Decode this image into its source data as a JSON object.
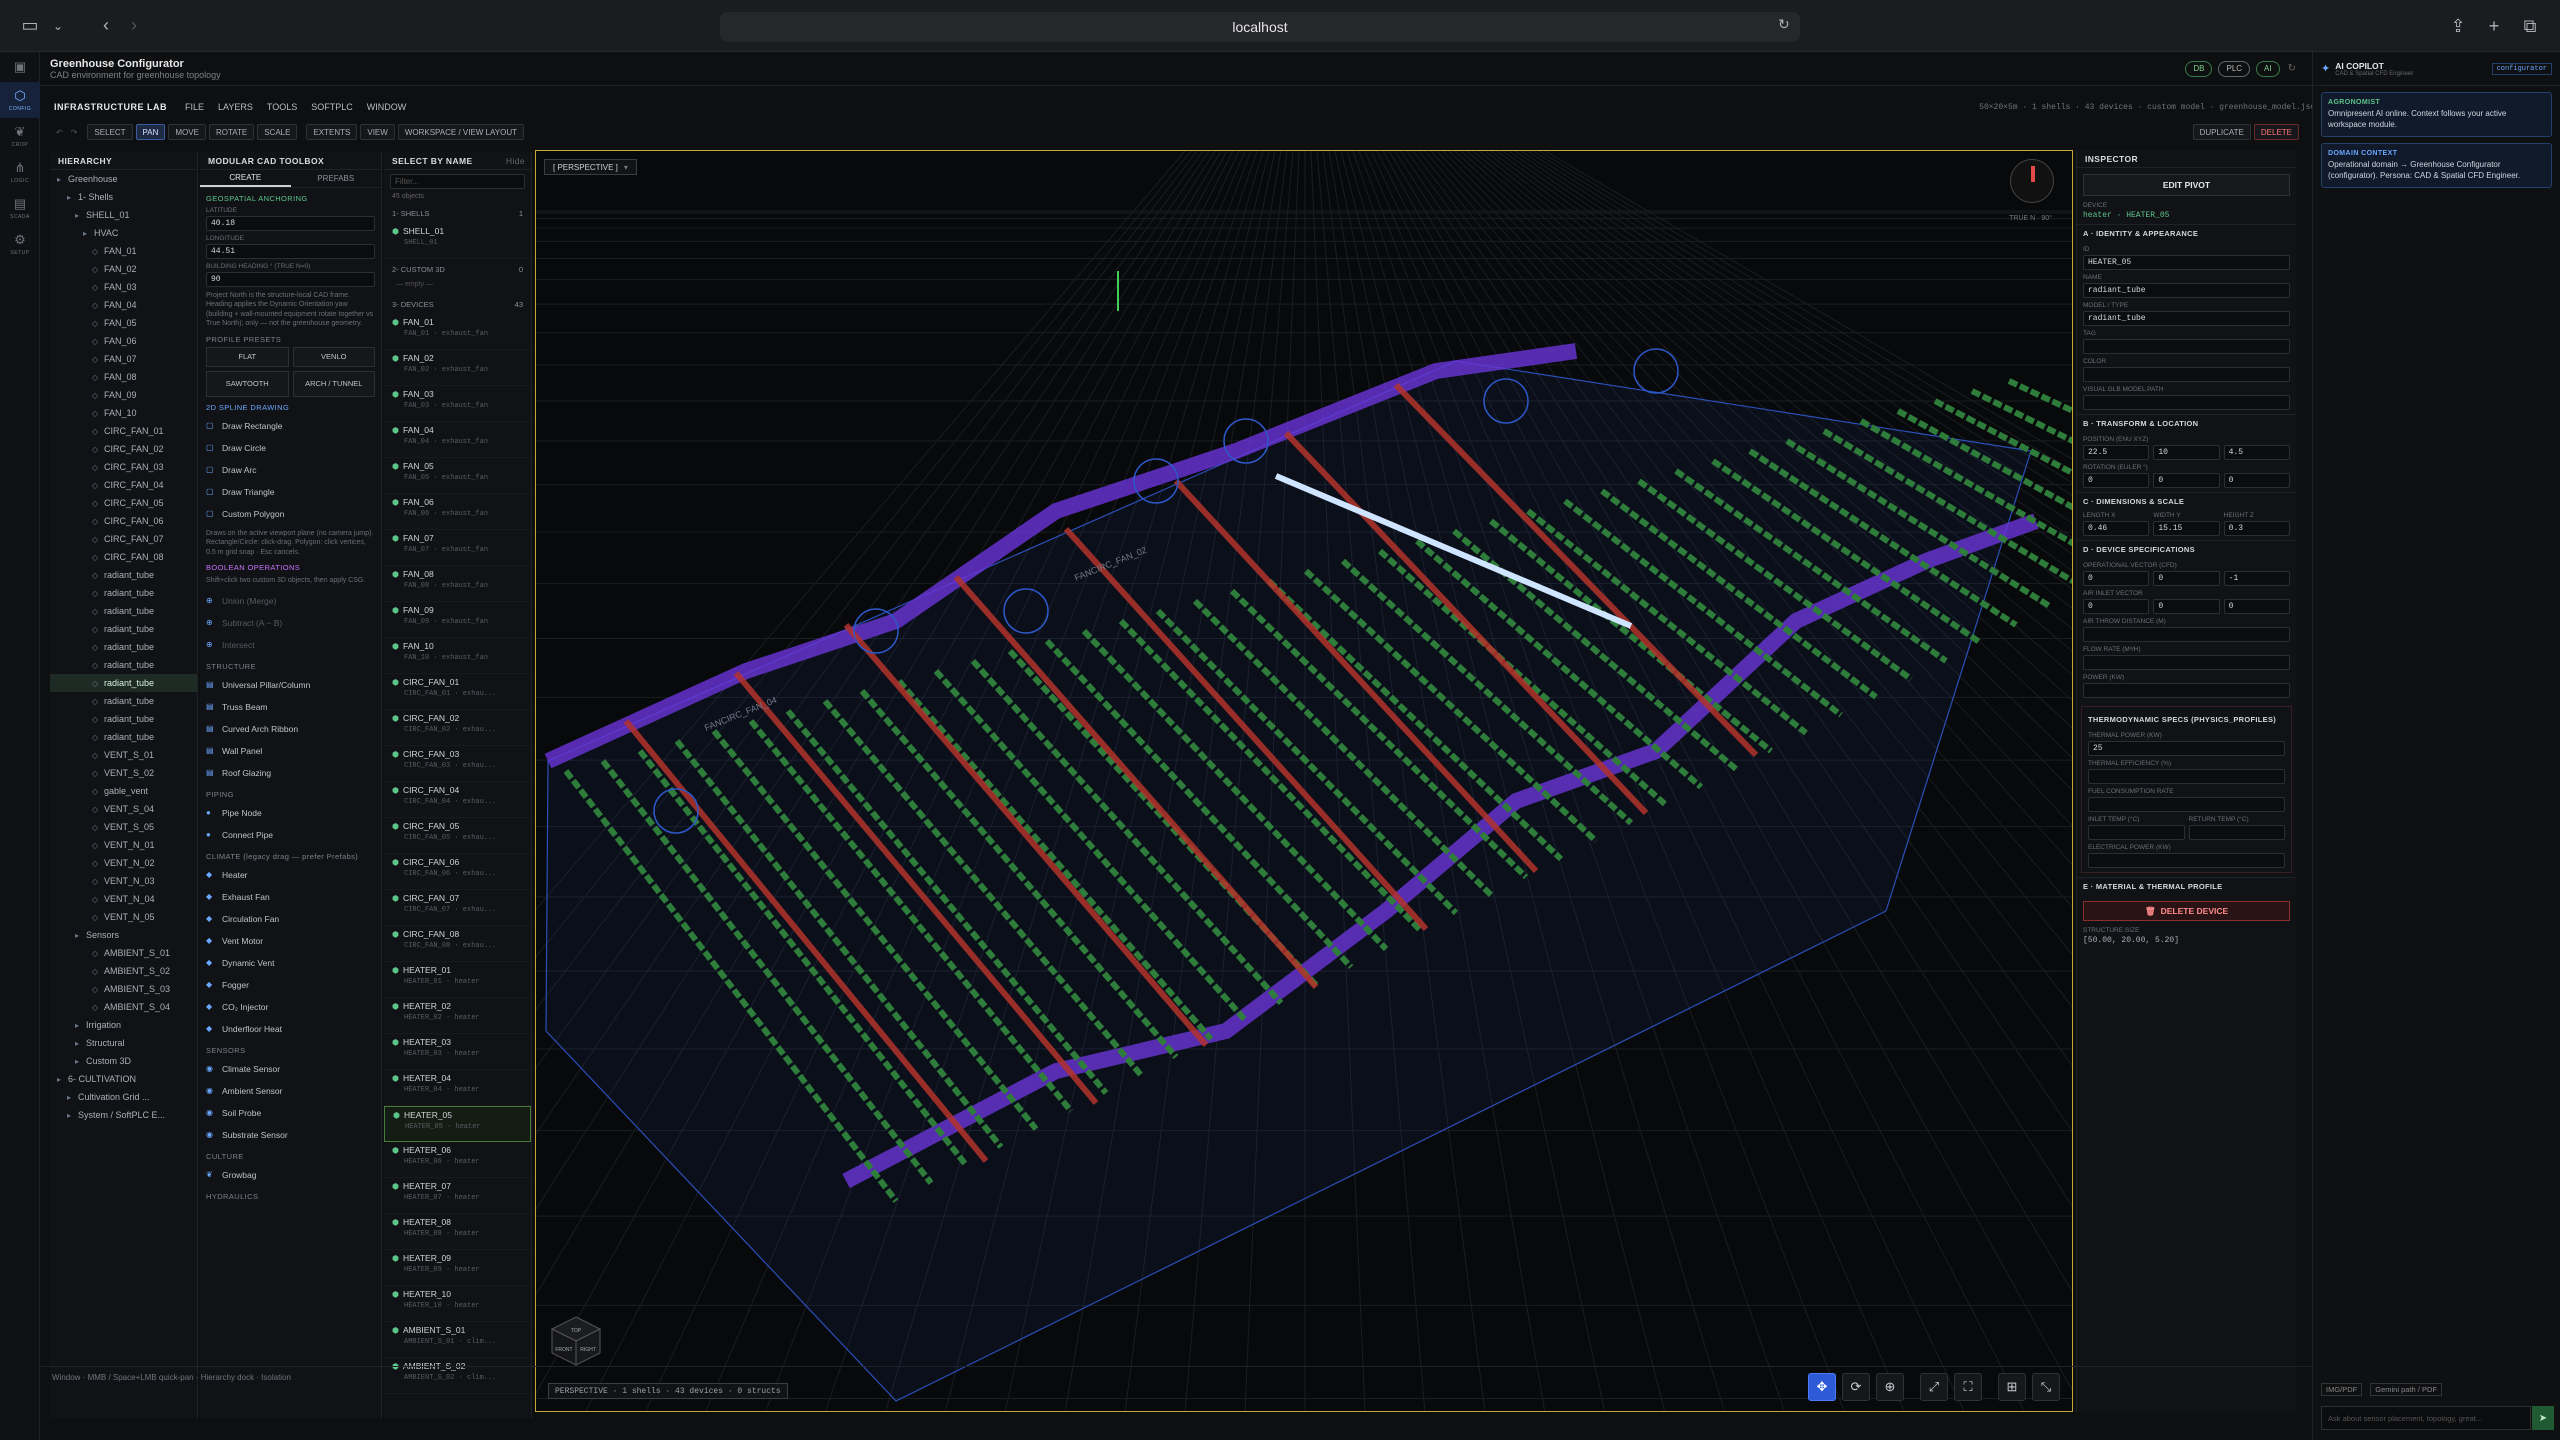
{
  "browser": {
    "url": "localhost"
  },
  "app": {
    "title": "Greenhouse Configurator",
    "subtitle": "CAD environment for greenhouse topology",
    "pills": [
      "DB",
      "PLC",
      "AI"
    ]
  },
  "rail": [
    {
      "label": "CONFIG"
    },
    {
      "label": "CROP"
    },
    {
      "label": "LOGIC"
    },
    {
      "label": "SCADA"
    },
    {
      "label": "SETUP"
    }
  ],
  "menu": {
    "brand": "INFRASTRUCTURE LAB",
    "items": [
      "FILE",
      "LAYERS",
      "TOOLS",
      "SOFTPLC",
      "WINDOW"
    ],
    "right": "50×20×5m · 1 shells · 43 devices · custom model · greenhouse_model.json"
  },
  "toolbar": {
    "tools": [
      "SELECT",
      "PAN",
      "MOVE",
      "ROTATE",
      "SCALE",
      "EXTENTS",
      "VIEW",
      "WORKSPACE / VIEW LAYOUT"
    ],
    "duplicate": "DUPLICATE",
    "delete": "DELETE"
  },
  "hierarchy": {
    "title": "HIERARCHY",
    "rows": [
      "Greenhouse",
      "1- Shells",
      "SHELL_01",
      "HVAC",
      "FAN_01",
      "FAN_02",
      "FAN_03",
      "FAN_04",
      "FAN_05",
      "FAN_06",
      "FAN_07",
      "FAN_08",
      "FAN_09",
      "FAN_10",
      "CIRC_FAN_01",
      "CIRC_FAN_02",
      "CIRC_FAN_03",
      "CIRC_FAN_04",
      "CIRC_FAN_05",
      "CIRC_FAN_06",
      "CIRC_FAN_07",
      "CIRC_FAN_08",
      "radiant_tube",
      "radiant_tube",
      "radiant_tube",
      "radiant_tube",
      "radiant_tube",
      "radiant_tube",
      "radiant_tube",
      "radiant_tube",
      "radiant_tube",
      "radiant_tube",
      "VENT_S_01",
      "VENT_S_02",
      "gable_vent",
      "VENT_S_04",
      "VENT_S_05",
      "VENT_N_01",
      "VENT_N_02",
      "VENT_N_03",
      "VENT_N_04",
      "VENT_N_05",
      "Sensors",
      "AMBIENT_S_01",
      "AMBIENT_S_02",
      "AMBIENT_S_03",
      "AMBIENT_S_04",
      "Irrigation",
      "Structural",
      "Custom 3D",
      "6- CULTIVATION",
      "Cultivation Grid ...",
      "System / SoftPLC E..."
    ]
  },
  "toolbox": {
    "title": "MODULAR CAD TOOLBOX",
    "tabs": [
      "CREATE",
      "PREFABS"
    ],
    "geo": {
      "title": "GEOSPATIAL ANCHORING",
      "lat_label": "LATITUDE",
      "lat": "40.18",
      "lon_label": "LONGITUDE",
      "lon": "44.51",
      "head_label": "BUILDING HEADING ° (TRUE N=0)",
      "head": "90",
      "note": "Project North is the structure-local CAD frame. Heading applies the Dynamic Orientation yaw (building + wall-mounted equipment rotate together vs True North); only — not the greenhouse geometry."
    },
    "presets": {
      "title": "PROFILE PRESETS",
      "items": [
        "FLAT",
        "VENLO",
        "SAWTOOTH",
        "ARCH / TUNNEL"
      ]
    },
    "spline": {
      "title": "2D SPLINE DRAWING",
      "items": [
        "Draw Rectangle",
        "Draw Circle",
        "Draw Arc",
        "Draw Triangle",
        "Custom Polygon"
      ],
      "note": "Draws on the active viewport plane (no camera jump). Rectangle/Circle: click-drag. Polygon: click vertices, 0.5 m grid snap · Esc cancels."
    },
    "bool": {
      "title": "BOOLEAN OPERATIONS",
      "note": "Shift+click two custom 3D objects, then apply CSG.",
      "items": [
        "Union (Merge)",
        "Subtract (A − B)",
        "Intersect"
      ]
    },
    "structure": {
      "title": "STRUCTURE",
      "items": [
        "Universal Pillar/Column",
        "Truss Beam",
        "Curved Arch Ribbon",
        "Wall Panel",
        "Roof Glazing"
      ]
    },
    "piping": {
      "title": "PIPING",
      "items": [
        "Pipe Node",
        "Connect Pipe"
      ]
    },
    "climate": {
      "title": "CLIMATE (legacy drag — prefer Prefabs)",
      "items": [
        "Heater",
        "Exhaust Fan",
        "Circulation Fan",
        "Vent Motor",
        "Dynamic Vent",
        "Fogger",
        "CO₂ Injector",
        "Underfloor Heat"
      ]
    },
    "sensors": {
      "title": "SENSORS",
      "items": [
        "Climate Sensor",
        "Ambient Sensor",
        "Soil Probe",
        "Substrate Sensor"
      ]
    },
    "culture": {
      "title": "CULTURE",
      "items": [
        "Growbag"
      ]
    },
    "hydraulics": {
      "title": "HYDRAULICS"
    }
  },
  "names": {
    "title": "SELECT BY NAME",
    "hide": "Hide",
    "filter_ph": "Filter...",
    "count": "45 objects",
    "groups": [
      {
        "label": "1- SHELLS",
        "count": "1",
        "items": [
          [
            "SHELL_01",
            "SHELL_01"
          ]
        ]
      },
      {
        "label": "2- CUSTOM 3D",
        "count": "0",
        "empty": "— empty —",
        "items": []
      },
      {
        "label": "3- DEVICES",
        "count": "43",
        "items": [
          [
            "FAN_01",
            "FAN_01 · exhaust_fan"
          ],
          [
            "FAN_02",
            "FAN_02 · exhaust_fan"
          ],
          [
            "FAN_03",
            "FAN_03 · exhaust_fan"
          ],
          [
            "FAN_04",
            "FAN_04 · exhaust_fan"
          ],
          [
            "FAN_05",
            "FAN_05 · exhaust_fan"
          ],
          [
            "FAN_06",
            "FAN_06 · exhaust_fan"
          ],
          [
            "FAN_07",
            "FAN_07 · exhaust_fan"
          ],
          [
            "FAN_08",
            "FAN_08 · exhaust_fan"
          ],
          [
            "FAN_09",
            "FAN_09 · exhaust_fan"
          ],
          [
            "FAN_10",
            "FAN_10 · exhaust_fan"
          ],
          [
            "CIRC_FAN_01",
            "CIRC_FAN_01 · exhau..."
          ],
          [
            "CIRC_FAN_02",
            "CIRC_FAN_02 · exhau..."
          ],
          [
            "CIRC_FAN_03",
            "CIRC_FAN_03 · exhau..."
          ],
          [
            "CIRC_FAN_04",
            "CIRC_FAN_04 · exhau..."
          ],
          [
            "CIRC_FAN_05",
            "CIRC_FAN_05 · exhau..."
          ],
          [
            "CIRC_FAN_06",
            "CIRC_FAN_06 · exhau..."
          ],
          [
            "CIRC_FAN_07",
            "CIRC_FAN_07 · exhau..."
          ],
          [
            "CIRC_FAN_08",
            "CIRC_FAN_08 · exhau..."
          ],
          [
            "HEATER_01",
            "HEATER_01 · heater"
          ],
          [
            "HEATER_02",
            "HEATER_02 · heater"
          ],
          [
            "HEATER_03",
            "HEATER_03 · heater"
          ],
          [
            "HEATER_04",
            "HEATER_04 · heater"
          ],
          [
            "HEATER_05",
            "HEATER_05 · heater"
          ],
          [
            "HEATER_06",
            "HEATER_06 · heater"
          ],
          [
            "HEATER_07",
            "HEATER_07 · heater"
          ],
          [
            "HEATER_08",
            "HEATER_08 · heater"
          ],
          [
            "HEATER_09",
            "HEATER_09 · heater"
          ],
          [
            "HEATER_10",
            "HEATER_10 · heater"
          ],
          [
            "AMBIENT_S_01",
            "AMBIENT_S_01 · clim..."
          ],
          [
            "AMBIENT_S_02",
            "AMBIENT_S_02 · clim..."
          ]
        ]
      }
    ],
    "selected": "HEATER_05"
  },
  "viewport": {
    "badge": "[ PERSPECTIVE ]",
    "status": "PERSPECTIVE · 1 shells · 43 devices · 0 structs",
    "compass": "TRUE N · 90°",
    "labels": [
      "FANCIRC_FAN_04",
      "FANCIRC_FAN_02"
    ],
    "cube": [
      "TOP",
      "FRONT",
      "RIGHT"
    ]
  },
  "inspector": {
    "title": "INSPECTOR",
    "edit_pivot": "EDIT PIVOT",
    "device_label": "DEVICE",
    "device": "heater · HEATER_05",
    "secA": "A · IDENTITY & APPEARANCE",
    "id_l": "ID",
    "id": "HEATER_05",
    "name_l": "NAME",
    "name": "radiant_tube",
    "model_l": "MODEL / TYPE",
    "model": "radiant_tube",
    "tag_l": "TAG",
    "color_l": "COLOR",
    "glb_l": "VISUAL GLB MODEL PATH",
    "secB": "B · TRANSFORM & LOCATION",
    "pos_l": "POSITION (ENU XYZ)",
    "pos": [
      "22.5",
      "10",
      "4.5"
    ],
    "rot_l": "ROTATION (EULER °)",
    "rot": [
      "0",
      "0",
      "0"
    ],
    "secC": "C · DIMENSIONS & SCALE",
    "dim_l": [
      "LENGTH X",
      "WIDTH Y",
      "HEIGHT Z"
    ],
    "dim": [
      "0.46",
      "15.15",
      "0.3"
    ],
    "secD": "D · DEVICE SPECIFICATIONS",
    "op_l": "OPERATIONAL VECTOR (CFD)",
    "op": [
      "0",
      "0",
      "-1"
    ],
    "air_l": "AIR INLET VECTOR",
    "air": [
      "0",
      "0",
      "0"
    ],
    "throw_l": "AIR THROW DISTANCE (M)",
    "flow_l": "FLOW RATE (M³/H)",
    "power_l": "POWER (KW)",
    "thermo": "THERMODYNAMIC SPECS (PHYSICS_PROFILES)",
    "tp_l": "THERMAL POWER (KW)",
    "tp": "25",
    "te_l": "THERMAL EFFICIENCY (%)",
    "fc_l": "FUEL CONSUMPTION RATE",
    "inlet_l": "INLET TEMP (°C)",
    "ret_l": "RETURN TEMP (°C)",
    "ep_l": "ELECTRICAL POWER (KW)",
    "secE": "E · MATERIAL & THERMAL PROFILE",
    "delete": "DELETE DEVICE",
    "size_l": "STRUCTURE.SIZE",
    "size": "[50.00, 20.00, 5.20]"
  },
  "copilot": {
    "title": "AI COPILOT",
    "sub": "CAD & Spatial CFD Engineer",
    "mode": "configurator",
    "card1_h": "AGRONOMIST",
    "card1": "Omnipresent AI online. Context follows your active workspace module.",
    "card2_h": "DOMAIN CONTEXT",
    "card2": "Operational domain → Greenhouse Configurator (configurator). Persona: CAD & Spatial CFD Engineer.",
    "img": "IMG/PDF",
    "path": "Gemini path / PDF",
    "input_ph": "Ask about sensor placement, topology, great..."
  },
  "statusbar": "Window · MMB / Space+LMB quick-pan · Hierarchy dock · Isolation",
  "colors": {
    "accent": "#2d5bd8",
    "crop": "#2e7d3a",
    "heater": "#b3322c",
    "shell": "#6a34d8",
    "select": "#c9a63a"
  }
}
